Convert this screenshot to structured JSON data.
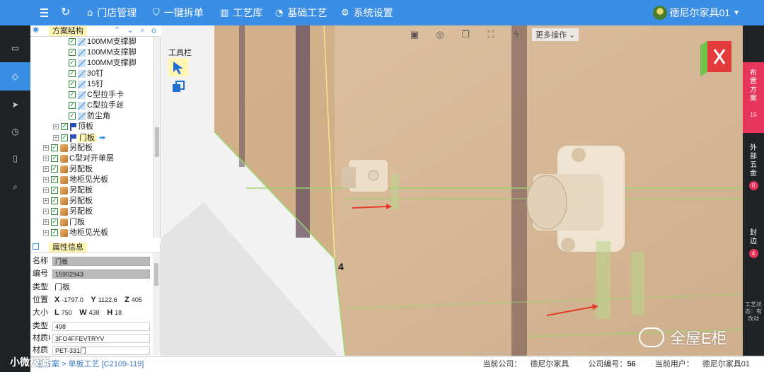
{
  "topbar": {
    "nav": [
      {
        "icon": "home-icon",
        "label": "门店管理"
      },
      {
        "icon": "shield-check-icon",
        "label": "一键拆单"
      },
      {
        "icon": "library-icon",
        "label": "工艺库"
      },
      {
        "icon": "palette-icon",
        "label": "基础工艺"
      },
      {
        "icon": "gear-icon",
        "label": "系统设置"
      }
    ],
    "user_name": "德尼尔家具01"
  },
  "rail": {
    "items": [
      "monitor-icon",
      "gem-icon",
      "send-icon",
      "clock-icon",
      "trash-icon",
      "search-icon"
    ],
    "active_index": 1
  },
  "tree_panel": {
    "title": "方案结构",
    "rows": [
      {
        "indent": 3,
        "expander": "",
        "icon": "part",
        "label": "100MM支撑脚",
        "highlight": false
      },
      {
        "indent": 3,
        "expander": "",
        "icon": "part",
        "label": "100MM支撑脚",
        "highlight": false
      },
      {
        "indent": 3,
        "expander": "",
        "icon": "part",
        "label": "100MM支撑脚",
        "highlight": false
      },
      {
        "indent": 3,
        "expander": "",
        "icon": "part",
        "label": "30钉",
        "highlight": false
      },
      {
        "indent": 3,
        "expander": "",
        "icon": "part",
        "label": "15钉",
        "highlight": false
      },
      {
        "indent": 3,
        "expander": "",
        "icon": "part",
        "label": "C型拉手卡",
        "highlight": false
      },
      {
        "indent": 3,
        "expander": "",
        "icon": "part",
        "label": "C型拉手丝",
        "highlight": false
      },
      {
        "indent": 3,
        "expander": "",
        "icon": "part",
        "label": "防尘角",
        "highlight": false
      },
      {
        "indent": 2,
        "expander": "+",
        "icon": "flag",
        "label": "顶板",
        "highlight": false
      },
      {
        "indent": 2,
        "expander": "+",
        "icon": "flag",
        "label": "门板",
        "highlight": true
      },
      {
        "indent": 1,
        "expander": "+",
        "icon": "box",
        "label": "另配板",
        "highlight": false
      },
      {
        "indent": 1,
        "expander": "+",
        "icon": "box",
        "label": "C型对开单层",
        "highlight": false
      },
      {
        "indent": 1,
        "expander": "+",
        "icon": "box",
        "label": "另配板",
        "highlight": false
      },
      {
        "indent": 1,
        "expander": "+",
        "icon": "box",
        "label": "地柜见光板",
        "highlight": false
      },
      {
        "indent": 1,
        "expander": "+",
        "icon": "box",
        "label": "另配板",
        "highlight": false
      },
      {
        "indent": 1,
        "expander": "+",
        "icon": "box",
        "label": "另配板",
        "highlight": false
      },
      {
        "indent": 1,
        "expander": "+",
        "icon": "box",
        "label": "另配板",
        "highlight": false
      },
      {
        "indent": 1,
        "expander": "+",
        "icon": "box",
        "label": "门板",
        "highlight": false
      },
      {
        "indent": 1,
        "expander": "+",
        "icon": "box",
        "label": "地柜见光板",
        "highlight": false
      }
    ]
  },
  "props": {
    "title": "属性信息",
    "name_label": "名称",
    "name_value": "门板",
    "code_label": "编号",
    "code_value": "15902943",
    "type_label": "类型",
    "type_value": "门板",
    "pos_label": "位置",
    "pos_x": "-1797.0",
    "pos_y": "1122.6",
    "pos_z": "405",
    "size_label": "大小",
    "size_l": "750",
    "size_w": "438",
    "size_h": "18",
    "type2_label": "类型",
    "type2_value": "498",
    "mat_id_label": "材质I",
    "mat_id_value": "3FO4FFEVTRYV",
    "mat_label": "材质",
    "mat_value": "PET-331门"
  },
  "viewport": {
    "toolbar_label": "工具栏",
    "more_ops": "更多操作",
    "marker_label": "4",
    "watermark": "全屋E柜"
  },
  "right_rail": {
    "blocks": [
      {
        "label": "布置方案",
        "count": "16"
      },
      {
        "label": "外部五金",
        "count": "0"
      },
      {
        "label": "封边",
        "count": "4"
      }
    ],
    "status_label": "工艺状态：有改动"
  },
  "status": {
    "breadcrumb": "总方案 > 单板工艺 [C2109-119]",
    "company_label": "当前公司：",
    "company": "德尼尔家具",
    "code_label": "公司编号：",
    "code": "56",
    "user_label": "当前用户：",
    "user": "德尼尔家具01"
  },
  "logo_text": "小微极道",
  "colors": {
    "accent": "#3a8ee6",
    "rail_bg": "#1f2326",
    "active_pink": "#e8335a",
    "highlight": "#fff6b3"
  }
}
